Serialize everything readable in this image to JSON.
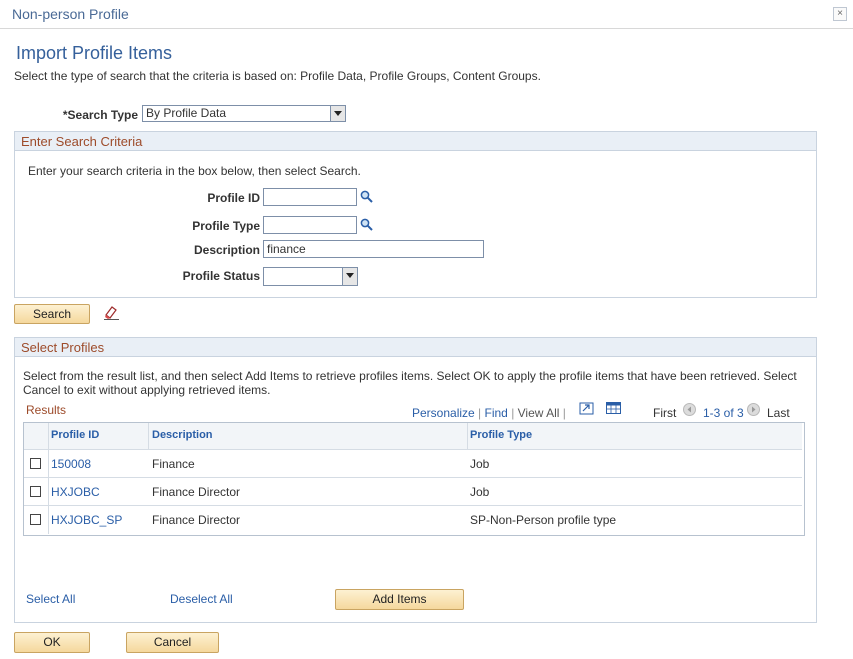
{
  "window": {
    "title": "Non-person Profile",
    "close_glyph": "×"
  },
  "page": {
    "title": "Import Profile Items",
    "instructions": "Select the type of search that the criteria is based on: Profile Data, Profile Groups, Content Groups."
  },
  "search_type": {
    "label": "*Search Type",
    "value": "By Profile Data"
  },
  "criteria": {
    "header": "Enter Search Criteria",
    "instructions": "Enter your search criteria in the box below, then select Search.",
    "profile_id": {
      "label": "Profile ID",
      "value": ""
    },
    "profile_type": {
      "label": "Profile Type",
      "value": ""
    },
    "description": {
      "label": "Description",
      "value": "finance"
    },
    "profile_status": {
      "label": "Profile Status",
      "value": ""
    }
  },
  "buttons": {
    "search": "Search",
    "add_items": "Add Items",
    "ok": "OK",
    "cancel": "Cancel",
    "select_all": "Select All",
    "deselect_all": "Deselect All"
  },
  "select_profiles": {
    "header": "Select Profiles",
    "instructions": "Select from the result list, and then select Add Items to retrieve profiles items. Select OK to apply the profile items that have been retrieved. Select Cancel to exit without applying retrieved items."
  },
  "results": {
    "title": "Results",
    "personalize": "Personalize",
    "find": "Find",
    "view_all": "View All",
    "first": "First",
    "range": "1-3 of 3",
    "last": "Last",
    "columns": [
      "Profile ID",
      "Description",
      "Profile Type"
    ],
    "rows": [
      {
        "profile_id": "150008",
        "description": "Finance",
        "profile_type": "Job"
      },
      {
        "profile_id": "HXJOBC",
        "description": "Finance Director",
        "profile_type": "Job"
      },
      {
        "profile_id": "HXJOBC_SP",
        "description": "Finance Director",
        "profile_type": "SP-Non-Person profile type"
      }
    ]
  },
  "icons": {
    "lookup": "magnifier-icon",
    "clear": "eraser-icon",
    "download": "download-to-spreadsheet-icon",
    "zoom": "zoom-grid-icon",
    "prev": "previous-arrow-icon",
    "next": "next-arrow-icon"
  },
  "colors": {
    "link": "#2a5ea7",
    "group_header_text": "#9d4b2a",
    "group_header_bg": "#e9eff6",
    "button_bg": "#f5d89d",
    "title_text": "#35609b"
  }
}
